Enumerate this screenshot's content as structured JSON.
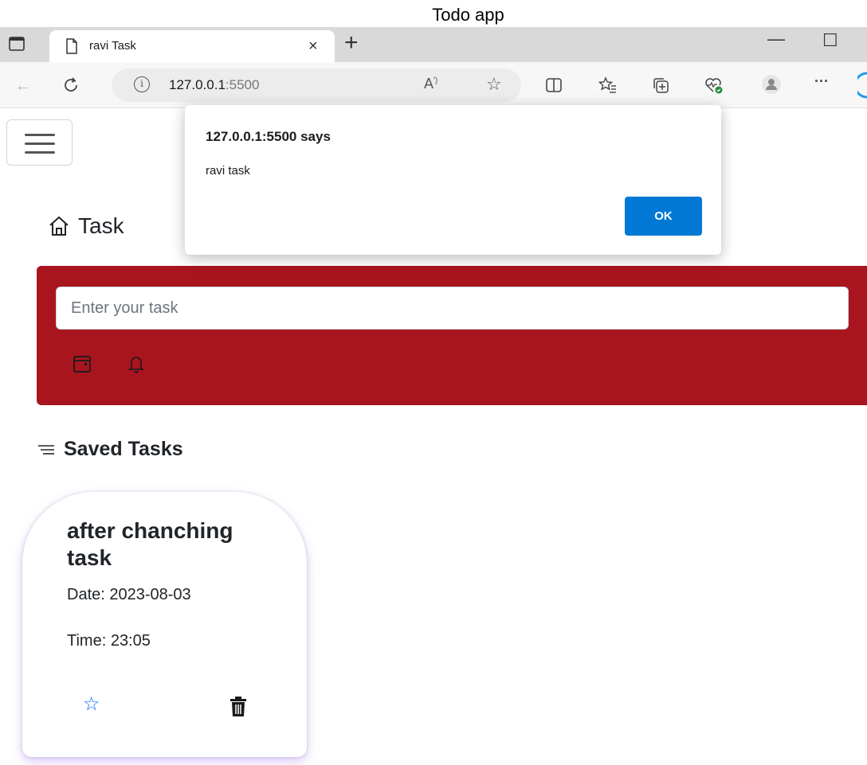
{
  "caption": "Todo app",
  "browser": {
    "tab_title": "ravi Task",
    "tab_close": "×",
    "new_tab": "+",
    "url_host": "127.0.0.1",
    "url_port": ":5500",
    "window_minimize": "—",
    "window_maximize": "☐",
    "more": "···"
  },
  "app": {
    "page_title": "Task",
    "input_placeholder": "Enter your task",
    "saved_title": "Saved Tasks",
    "accent_color": "#a8151f"
  },
  "tasks": [
    {
      "title": "after chanching task",
      "date": "Date: 2023-08-03",
      "time": "Time: 23:05"
    }
  ],
  "dialog": {
    "origin": "127.0.0.1:5500 says",
    "message": "ravi task",
    "ok_label": "OK"
  }
}
